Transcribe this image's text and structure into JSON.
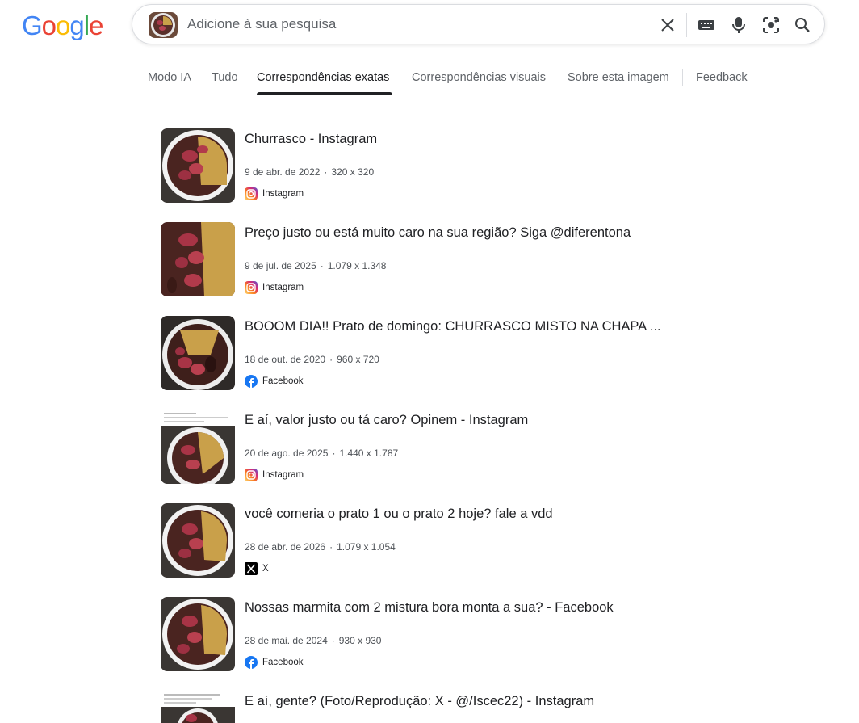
{
  "logo": {
    "letters": [
      "G",
      "o",
      "o",
      "g",
      "l",
      "e"
    ],
    "colors": [
      "#4285F4",
      "#EA4335",
      "#FBBC05",
      "#4285F4",
      "#34A853",
      "#EA4335"
    ]
  },
  "search": {
    "placeholder": "Adicione à sua pesquisa",
    "icons": [
      "close-icon",
      "keyboard-icon",
      "mic-icon",
      "lens-icon",
      "search-icon"
    ]
  },
  "tabs": [
    {
      "label": "Modo IA",
      "active": false
    },
    {
      "label": "Tudo",
      "active": false
    },
    {
      "label": "Correspondências exatas",
      "active": true
    },
    {
      "label": "Correspondências visuais",
      "active": false
    },
    {
      "label": "Sobre esta imagem",
      "active": false
    },
    {
      "label": "Feedback",
      "active": false
    }
  ],
  "results": [
    {
      "title": "Churrasco - Instagram",
      "date": "9 de abr. de 2022",
      "dims": "320 x 320",
      "source": "Instagram",
      "source_icon": "instagram-icon"
    },
    {
      "title": "Preço justo ou está muito caro na sua região? Siga @diferentona",
      "date": "9 de jul. de 2025",
      "dims": "1.079 x 1.348",
      "source": "Instagram",
      "source_icon": "instagram-icon"
    },
    {
      "title": "BOOOM DIA!! Prato de domingo: CHURRASCO MISTO NA CHAPA ...",
      "date": "18 de out. de 2020",
      "dims": "960 x 720",
      "source": "Facebook",
      "source_icon": "facebook-icon"
    },
    {
      "title": "E aí, valor justo ou tá caro? Opinem - Instagram",
      "date": "20 de ago. de 2025",
      "dims": "1.440 x 1.787",
      "source": "Instagram",
      "source_icon": "instagram-icon"
    },
    {
      "title": "você comeria o prato 1 ou o prato 2 hoje? fale a vdd",
      "date": "28 de abr. de 2026",
      "dims": "1.079 x 1.054",
      "source": "X",
      "source_icon": "x-icon"
    },
    {
      "title": "Nossas marmita com 2 mistura bora monta a sua? - Facebook",
      "date": "28 de mai. de 2024",
      "dims": "930 x 930",
      "source": "Facebook",
      "source_icon": "facebook-icon"
    },
    {
      "title": "E aí, gente? (Foto/Reprodução: X - @/Iscec22) - Instagram",
      "date": "",
      "dims": "",
      "source": "",
      "source_icon": ""
    }
  ]
}
